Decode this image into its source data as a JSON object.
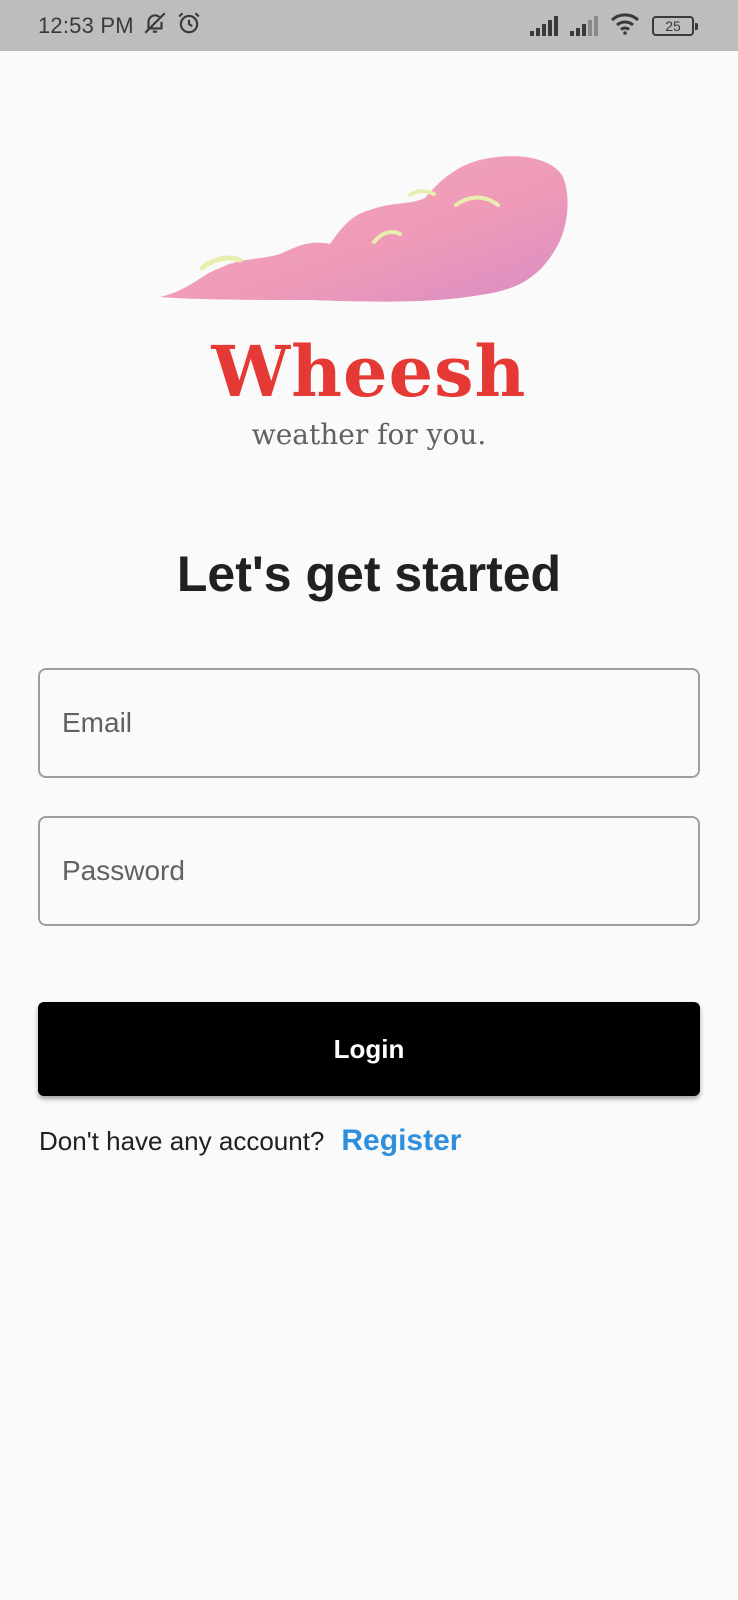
{
  "status_bar": {
    "time": "12:53 PM",
    "battery": "25",
    "icons": [
      "bell-off-icon",
      "alarm-icon",
      "signal-icon",
      "signal-weak-icon",
      "wifi-icon",
      "battery-icon"
    ]
  },
  "brand": {
    "logo": "cloud-logo",
    "title": "Wheesh",
    "tagline": "weather for you.",
    "title_color": "#e53935"
  },
  "form": {
    "heading": "Let's get started",
    "email_placeholder": "Email",
    "password_placeholder": "Password",
    "login_label": "Login"
  },
  "footer": {
    "prompt": "Don't have any account?",
    "register_label": "Register",
    "link_color": "#2f8fdc"
  }
}
